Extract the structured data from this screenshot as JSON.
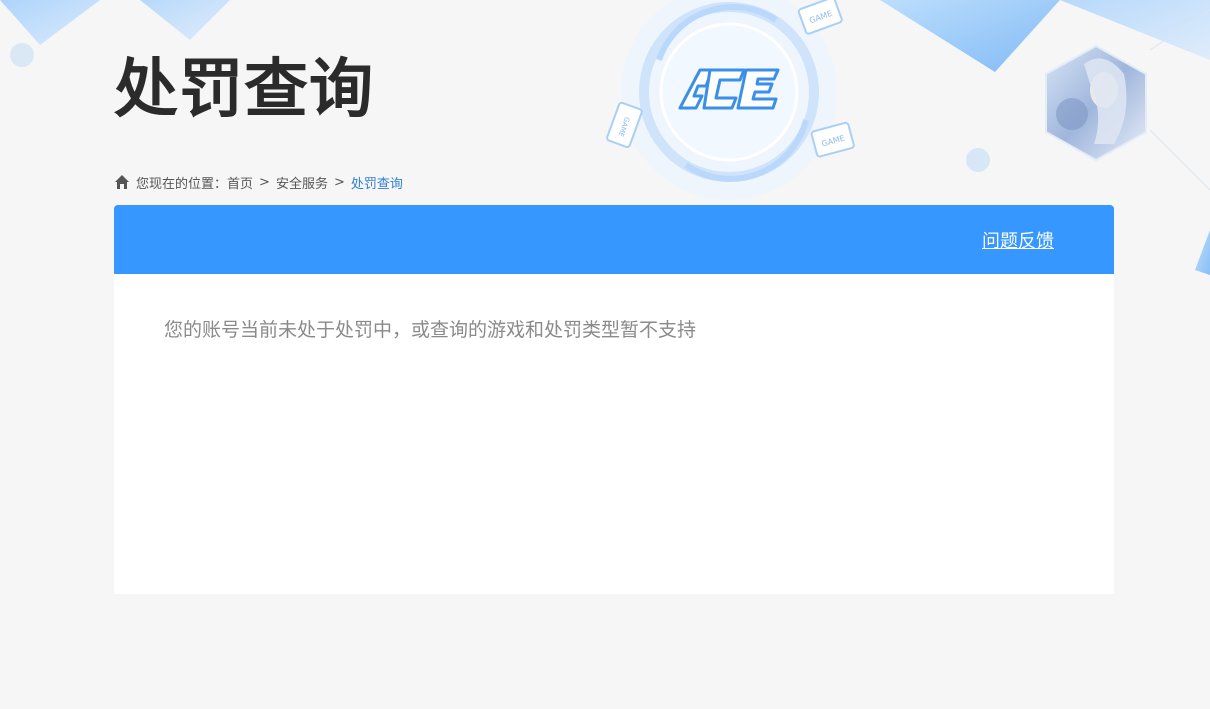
{
  "header": {
    "title": "处罚查询"
  },
  "breadcrumb": {
    "prefix": "您现在的位置：",
    "items": [
      "首页",
      "安全服务"
    ],
    "current": "处罚查询",
    "separator": ">"
  },
  "panel": {
    "feedback_label": "问题反馈",
    "message": "您的账号当前未处于处罚中，或查询的游戏和处罚类型暂不支持"
  },
  "logo": {
    "ace_text": "ACE",
    "game_tag": "GAME"
  },
  "colors": {
    "accent": "#3597ff",
    "breadcrumb_current": "#2f7fd6",
    "title": "#2b2b2b",
    "message": "#8a8a8a"
  }
}
